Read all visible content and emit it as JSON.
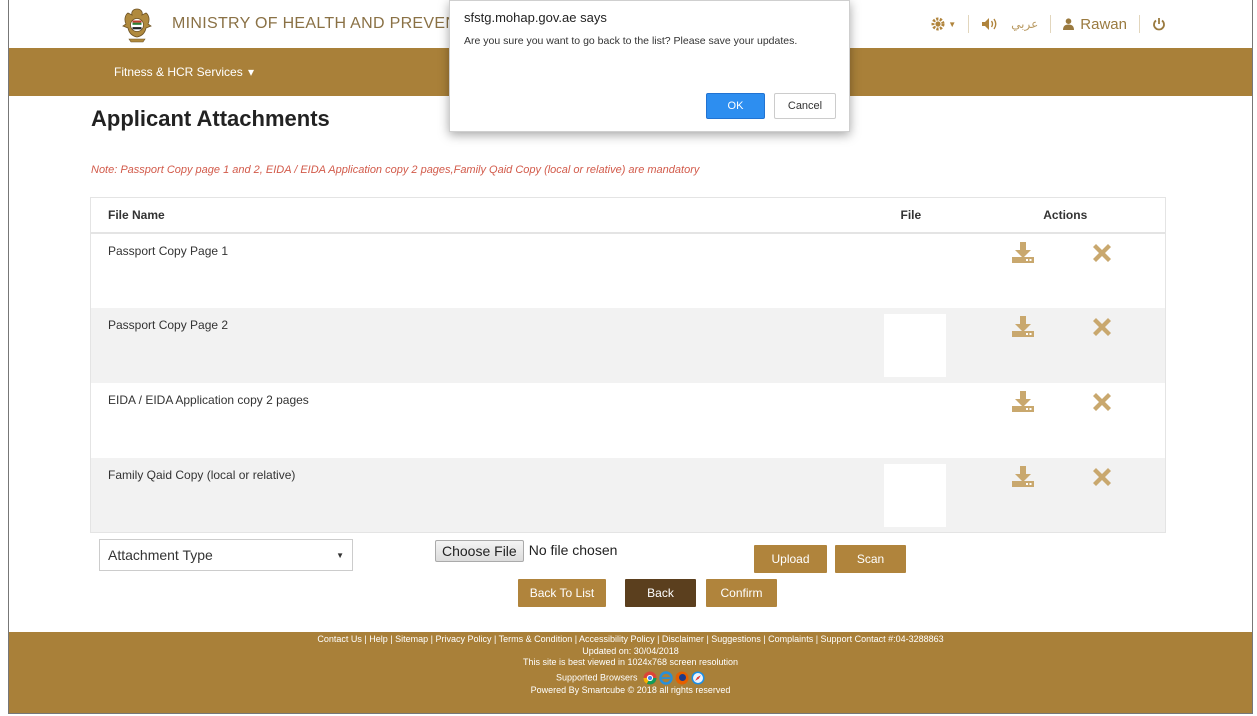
{
  "header": {
    "ministry_name": "MINISTRY OF HEALTH AND PREVEN",
    "language_label": "عربي",
    "user_name": "Rawan"
  },
  "nav": {
    "menu_label": "Fitness & HCR Services",
    "menu_caret": "▾"
  },
  "page": {
    "title": "Applicant Attachments",
    "note": "Note: Passport Copy page 1 and 2, EIDA / EIDA Application copy 2 pages,Family Qaid Copy (local or relative) are mandatory"
  },
  "table": {
    "headers": {
      "file_name": "File Name",
      "file": "File",
      "actions": "Actions"
    },
    "rows": [
      {
        "name": "Passport Copy Page 1",
        "has_file": false
      },
      {
        "name": "Passport Copy Page 2",
        "has_file": true
      },
      {
        "name": "EIDA / EIDA Application copy 2 pages",
        "has_file": false
      },
      {
        "name": "Family Qaid Copy (local or relative)",
        "has_file": true
      }
    ],
    "action_icons": [
      "download-icon",
      "delete-icon"
    ]
  },
  "form": {
    "attachment_type_value": "Attachment Type",
    "choose_file_label": "Choose File",
    "no_file_text": "No file chosen",
    "upload_label": "Upload",
    "scan_label": "Scan",
    "back_to_list_label": "Back To List",
    "back_label": "Back",
    "confirm_label": "Confirm"
  },
  "footer": {
    "links": [
      "Contact Us",
      "Help",
      "Sitemap",
      "Privacy Policy",
      "Terms & Condition",
      "Accessibility Policy",
      "Disclaimer",
      "Suggestions",
      "Complaints"
    ],
    "support_contact": "Support Contact #:04-3288863",
    "updated": "Updated on: 30/04/2018",
    "resolution_note": "This site is best viewed in 1024x768 screen resolution",
    "supported_browsers": "Supported Browsers",
    "powered_by": "Powered By Smartcube © 2018 all rights reserved"
  },
  "dialog": {
    "title": "sfstg.mohap.gov.ae says",
    "message": "Are you sure you want to go back to the list? Please save your updates.",
    "ok_label": "OK",
    "cancel_label": "Cancel"
  },
  "colors": {
    "brand_gold": "#a98039",
    "button_gold": "#b0843c",
    "button_dark": "#5b3f1e",
    "note_red": "#d25a4a",
    "dialog_ok_blue": "#2d8ef0"
  }
}
